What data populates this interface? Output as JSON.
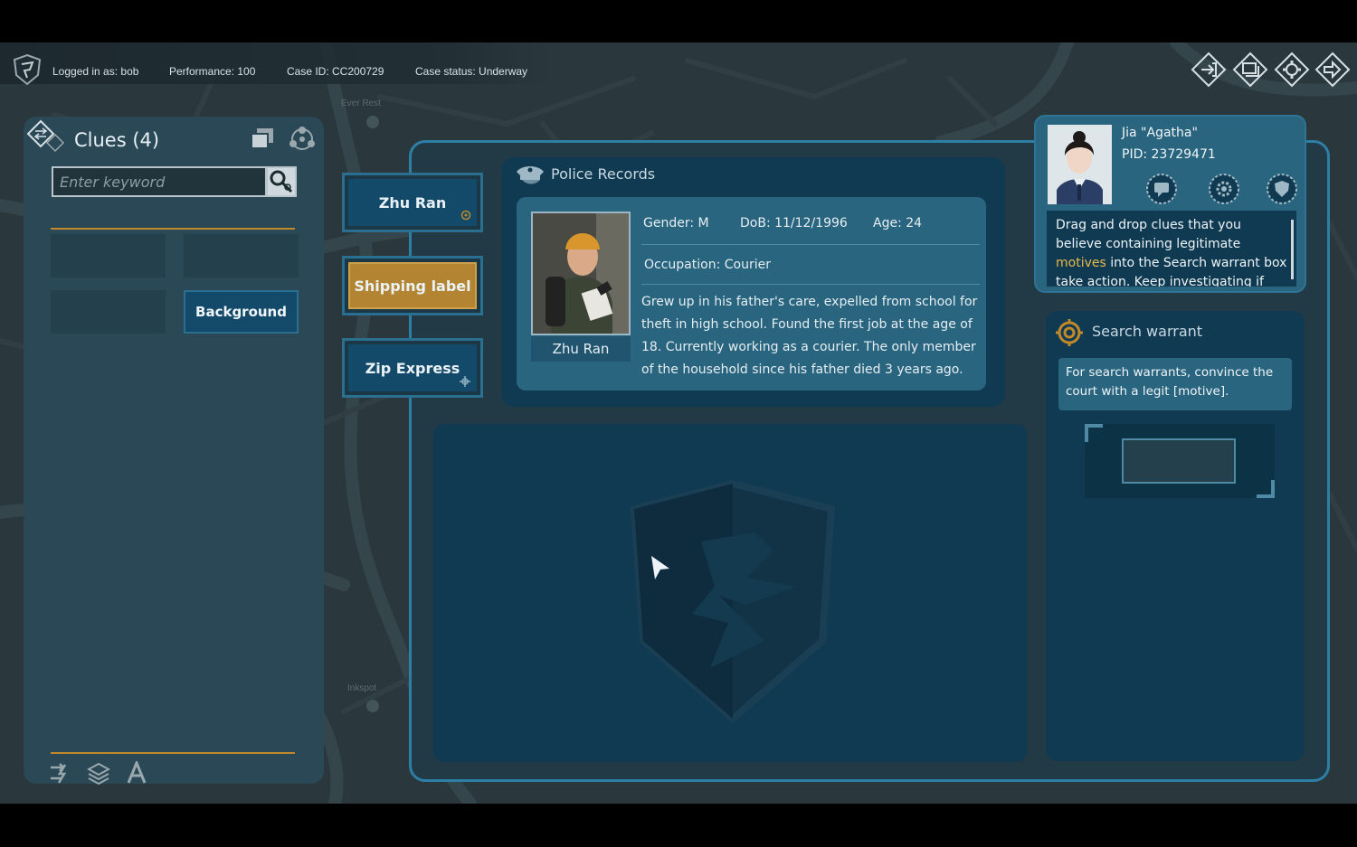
{
  "status_bar": {
    "logged_in": "Logged in as: bob",
    "performance": "Performance: 100",
    "case_id": "Case ID: CC200729",
    "case_status": "Case status: Underway"
  },
  "top_icons": [
    "enter-icon",
    "windows-icon",
    "gear-icon",
    "exit-icon"
  ],
  "map_labels": {
    "place_1": "Ever Rest",
    "place_2": "Inkspot"
  },
  "clues_panel": {
    "title": "Clues (4)",
    "search_placeholder": "Enter keyword",
    "search_value": "",
    "slots": [
      "",
      "",
      "",
      "Background"
    ],
    "bottom_icons": [
      "shuffle-icon",
      "layers-icon",
      "font-icon"
    ]
  },
  "subject_tabs": [
    {
      "label": "Zhu Ran",
      "active": false
    },
    {
      "label": "Shipping label",
      "active": true
    },
    {
      "label": "Zip Express",
      "active": false
    }
  ],
  "police_records": {
    "header": "Police Records",
    "name": "Zhu Ran",
    "gender": "Gender: M",
    "dob": "DoB: 11/12/1996",
    "age": "Age: 24",
    "occupation": "Occupation: Courier",
    "bio": "Grew up in his father's care, expelled from school for theft in high school. Found the first job at the age of 18. Currently working as a courier. The only member of the household since his father died 3 years ago."
  },
  "agent": {
    "name": "Jia \"Agatha\"",
    "pid": "PID: 23729471",
    "icons": [
      "chat-icon",
      "gear-badge-icon",
      "shield-badge-icon"
    ],
    "hint_before": "Drag and drop clues that you believe containing legitimate ",
    "hint_highlight": "motives",
    "hint_after": " into the Search warrant box take action. Keep investigating if you don't have the"
  },
  "search_warrant": {
    "title": "Search warrant",
    "note": "For search warrants, convince the court with a legit [motive]."
  },
  "colors": {
    "accent_blue": "#2e7fa5",
    "accent_orange": "#c08a2a",
    "highlight": "#e8b84a",
    "active_tab": "#b38532"
  }
}
